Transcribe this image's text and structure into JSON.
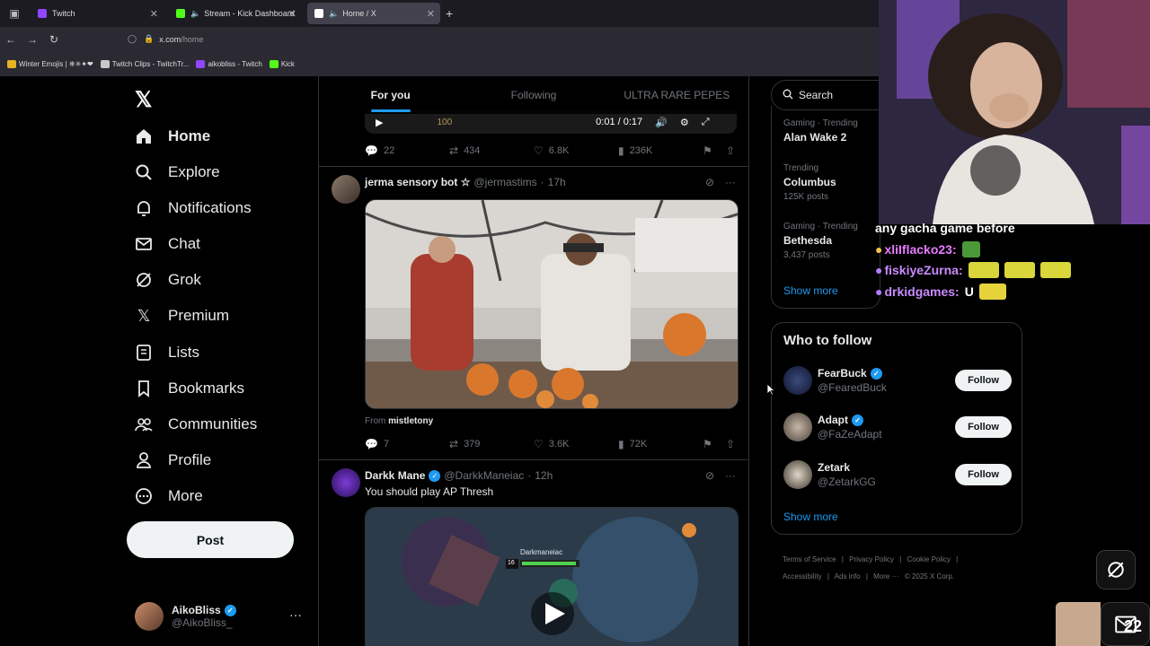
{
  "browser": {
    "tabs": [
      {
        "title": "Twitch",
        "color": "#9146ff"
      },
      {
        "title": "Stream - Kick Dashboard",
        "color": "#53fc18"
      },
      {
        "title": "Home / X",
        "color": "#ffffff"
      }
    ],
    "url_domain": "x.com",
    "url_path": "/home",
    "bookmarks": [
      {
        "label": "Winter Emojis | ❄✳✦❤",
        "color": "#e6b422"
      },
      {
        "label": "Twitch Clips - TwitchTr...",
        "color": "#c8c8c8"
      },
      {
        "label": "aikobliss - Twitch",
        "color": "#9146ff"
      },
      {
        "label": "Kick",
        "color": "#53fc18"
      }
    ]
  },
  "nav": {
    "items": [
      {
        "label": "Home",
        "icon": "home-icon"
      },
      {
        "label": "Explore",
        "icon": "search-icon"
      },
      {
        "label": "Notifications",
        "icon": "bell-icon"
      },
      {
        "label": "Chat",
        "icon": "mail-icon"
      },
      {
        "label": "Grok",
        "icon": "grok-icon"
      },
      {
        "label": "Premium",
        "icon": "x-icon"
      },
      {
        "label": "Lists",
        "icon": "list-icon"
      },
      {
        "label": "Bookmarks",
        "icon": "bookmark-icon"
      },
      {
        "label": "Communities",
        "icon": "people-icon"
      },
      {
        "label": "Profile",
        "icon": "person-icon"
      },
      {
        "label": "More",
        "icon": "more-circle-icon"
      }
    ],
    "post_label": "Post",
    "account": {
      "name": "AikoBliss",
      "handle": "@AikoBliss_"
    }
  },
  "feed": {
    "tabs": [
      "For you",
      "Following",
      "ULTRA RARE PEPES"
    ],
    "video_time": "0:01 / 0:17",
    "video_scoreboard": "100",
    "tweet0_actions": {
      "replies": "22",
      "reposts": "434",
      "likes": "6.8K",
      "views": "236K"
    },
    "tweet1": {
      "name": "jerma sensory bot ☆",
      "handle": "@jermastims",
      "time": "17h",
      "from_label": "From",
      "from_user": "mistletony",
      "replies": "7",
      "reposts": "379",
      "likes": "3.6K",
      "views": "72K"
    },
    "tweet2": {
      "name": "Darkk Mane",
      "handle": "@DarkkManeiac",
      "time": "12h",
      "text": "You should play AP Thresh",
      "game_name": "Darkmaneiac",
      "game_level": "16"
    }
  },
  "right": {
    "search_placeholder": "Search",
    "trends": [
      {
        "category": "Gaming · Trending",
        "topic": "Alan Wake 2",
        "count": ""
      },
      {
        "category": "Trending",
        "topic": "Columbus",
        "count": "125K posts"
      },
      {
        "category": "Gaming · Trending",
        "topic": "Bethesda",
        "count": "3,437 posts"
      }
    ],
    "trends_show_more": "Show more",
    "who_to_follow_title": "Who to follow",
    "people": [
      {
        "name": "FearBuck",
        "handle": "@FearedBuck"
      },
      {
        "name": "Adapt",
        "handle": "@FaZeAdapt"
      },
      {
        "name": "Zetark",
        "handle": "@ZetarkGG"
      }
    ],
    "follow_label": "Follow",
    "wtf_show_more": "Show more",
    "footer": [
      "Terms of Service",
      "|",
      "Privacy Policy",
      "|",
      "Cookie Policy",
      "|",
      "Accessibility",
      "|",
      "Ads info",
      "|",
      "More ···",
      "© 2025 X Corp."
    ]
  },
  "overlay": {
    "chat": [
      {
        "user": "",
        "msg": "any gacha game before",
        "color": "#ffffff"
      },
      {
        "user": "xliIflacko23:",
        "msg": "",
        "color": "#d57bff"
      },
      {
        "user": "fiskiyeZurna:",
        "msg": "",
        "color": "#b57bff"
      },
      {
        "user": "drkidgames:",
        "msg": "U",
        "color": "#b57bff"
      }
    ],
    "msg_badge": "22"
  }
}
